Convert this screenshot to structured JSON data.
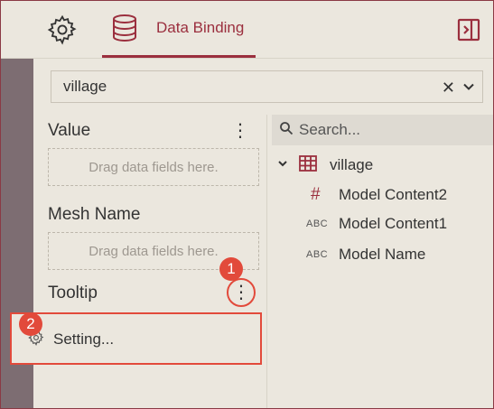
{
  "header": {
    "settings_icon": "gear-icon",
    "tab_icon": "database-icon",
    "tab_label": "Data Binding",
    "panel_toggle_icon": "panel-toggle-icon"
  },
  "dataset": {
    "selected": "village",
    "clear_glyph": "✕"
  },
  "fields": {
    "value": {
      "title": "Value",
      "dropzone": "Drag data fields here."
    },
    "mesh_name": {
      "title": "Mesh Name",
      "dropzone": "Drag data fields here."
    },
    "tooltip": {
      "title": "Tooltip"
    }
  },
  "menu": {
    "setting_label": "Setting..."
  },
  "annotations": {
    "step1": "1",
    "step2": "2",
    "color": "#e24a3b"
  },
  "search": {
    "placeholder": "Search..."
  },
  "tree": {
    "root": "village",
    "items": [
      {
        "type": "#",
        "label": "Model Content2"
      },
      {
        "type": "ABC",
        "label": "Model Content1"
      },
      {
        "type": "ABC",
        "label": "Model Name"
      }
    ]
  },
  "colors": {
    "accent": "#9b2f3e",
    "background": "#ebe7de",
    "left_strip": "#7d6d72"
  }
}
